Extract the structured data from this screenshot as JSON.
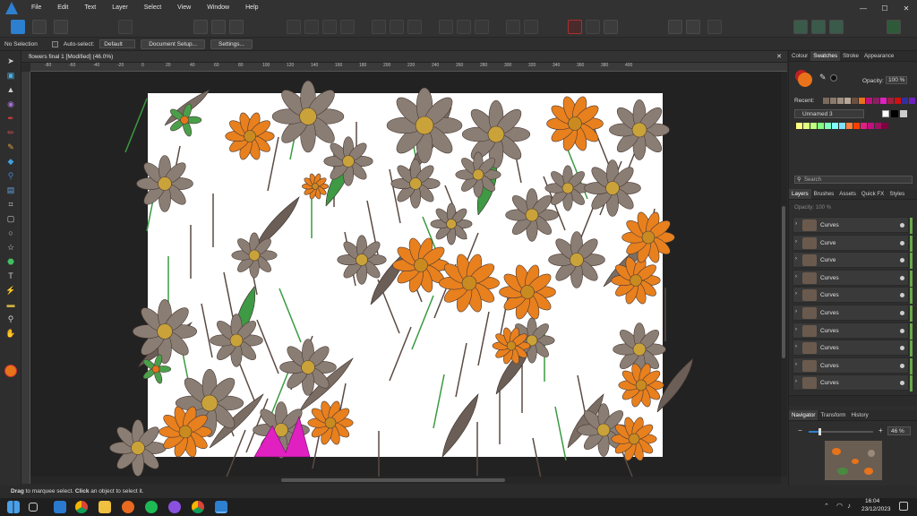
{
  "menubar": {
    "items": [
      "File",
      "Edit",
      "Text",
      "Layer",
      "Select",
      "View",
      "Window",
      "Help"
    ],
    "window_controls": [
      "—",
      "☐",
      "✕"
    ]
  },
  "contextbar": {
    "selection": "No Selection",
    "auto_select_label": "Auto-select:",
    "auto_select_value": "Default",
    "document_setup": "Document Setup...",
    "settings": "Settings..."
  },
  "document": {
    "tab_title": "flowers final 1 [Modified] (46.0%)",
    "ruler_labels": [
      "-80",
      "-60",
      "-40",
      "-20",
      "0",
      "20",
      "40",
      "60",
      "80",
      "100",
      "120",
      "140",
      "160",
      "180",
      "200",
      "220",
      "240",
      "260",
      "280",
      "300",
      "320",
      "340",
      "360",
      "380",
      "400"
    ]
  },
  "status": {
    "text_bold1": "Drag",
    "text1": " to marquee select. ",
    "text_bold2": "Click",
    "text2": " an object to select it."
  },
  "panel": {
    "colour_tabs": [
      "Colour",
      "Swatches",
      "Stroke",
      "Appearance"
    ],
    "active_colour_tab": "Swatches",
    "opacity_label": "Opacity:",
    "opacity_value": "100 %",
    "recent_label": "Recent:",
    "palette_name": "Unnamed 3",
    "search_placeholder": "Search",
    "layer_tabs": [
      "Layers",
      "Brushes",
      "Assets",
      "Quick FX",
      "Styles"
    ],
    "active_layer_tab": "Layers",
    "layers_opacity_label": "Opacity:",
    "layers_opacity_value": "100 %",
    "layers": [
      "Curves",
      "Curve",
      "Curve",
      "Curves",
      "Curves",
      "Curves",
      "Curves",
      "Curves",
      "Curves",
      "Curves"
    ],
    "nav_tabs": [
      "Navigator",
      "Transform",
      "History"
    ],
    "active_nav_tab": "Navigator",
    "zoom_value": "46 %",
    "minus": "−",
    "plus": "+"
  },
  "colors": {
    "accent": "#2d7fcf",
    "primary_fill": "#e8731a",
    "layer_green": "#6ba84a",
    "recent_swatches": [
      "#7a6a5e",
      "#8a7a6c",
      "#a09080",
      "#b8a898",
      "#6a5040",
      "#e8731a",
      "#c01080",
      "#8a2060",
      "#e020c0",
      "#a02040",
      "#d01010",
      "#3030a0",
      "#7020c0"
    ],
    "palette_swatches": [
      "#ffff80",
      "#e0ff80",
      "#c0ff80",
      "#80ff80",
      "#80ffc0",
      "#80ffff",
      "#80e0ff",
      "#ff8040",
      "#ff4000",
      "#e02080",
      "#c01080",
      "#a01060",
      "#800040"
    ]
  },
  "taskbar": {
    "time": "16:04",
    "date": "23/12/2023"
  }
}
